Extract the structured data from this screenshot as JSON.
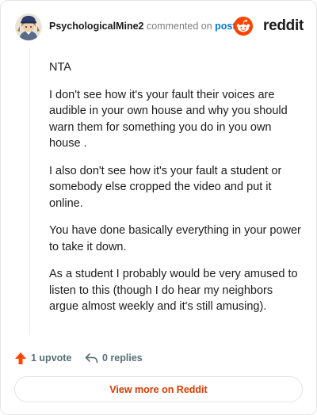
{
  "comment": {
    "author": "PsychologicalMine2",
    "action_text": "commented on",
    "post_link_text": "post",
    "paragraphs": [
      "NTA",
      "I don't see how it's your fault their voices are audible in your own house and why you should warn them for something you do in you own house .",
      "I also don't see how it's your fault a student or somebody else cropped the video and put it online.",
      "You have done basically everything in your power to take it down.",
      "As a student I probably would be very amused to listen to this (though I do hear my neighbors argue almost weekly and it's still amusing)."
    ]
  },
  "brand": {
    "name": "reddit",
    "icon": "reddit-logo-icon",
    "color": "#ff4500"
  },
  "actions": {
    "upvote_label": "1 upvote",
    "replies_label": "0 replies",
    "upvote_icon": "upvote-arrow-icon",
    "reply_icon": "reply-arrow-icon",
    "upvote_color": "#ff4500"
  },
  "footer": {
    "view_more_label": "View more on Reddit",
    "accent_color": "#d93a00"
  }
}
